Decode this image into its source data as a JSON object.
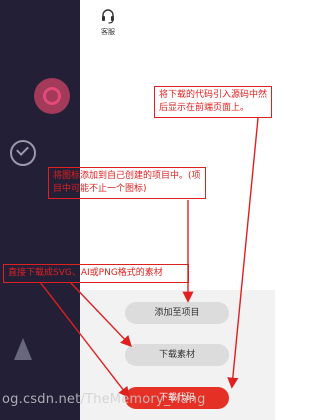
{
  "header": {
    "service_label": "客服"
  },
  "actions": {
    "add_to_project": "添加至项目",
    "download_material": "下载素材",
    "download_code": "下载代码"
  },
  "annotations": {
    "note_1": "将下载的代码引入源码中然后显示在前端页面上。",
    "note_2": "将图标添加到自己创建的项目中。(项目中可能不止一个图标)",
    "note_3": "直接下载成SVG、AI或PNG格式的素材"
  },
  "watermark": "og.csdn.net/TheMemory_Hang",
  "colors": {
    "accent": "#e53025",
    "annotation": "#e02020",
    "dark_bg": "#221f37"
  }
}
